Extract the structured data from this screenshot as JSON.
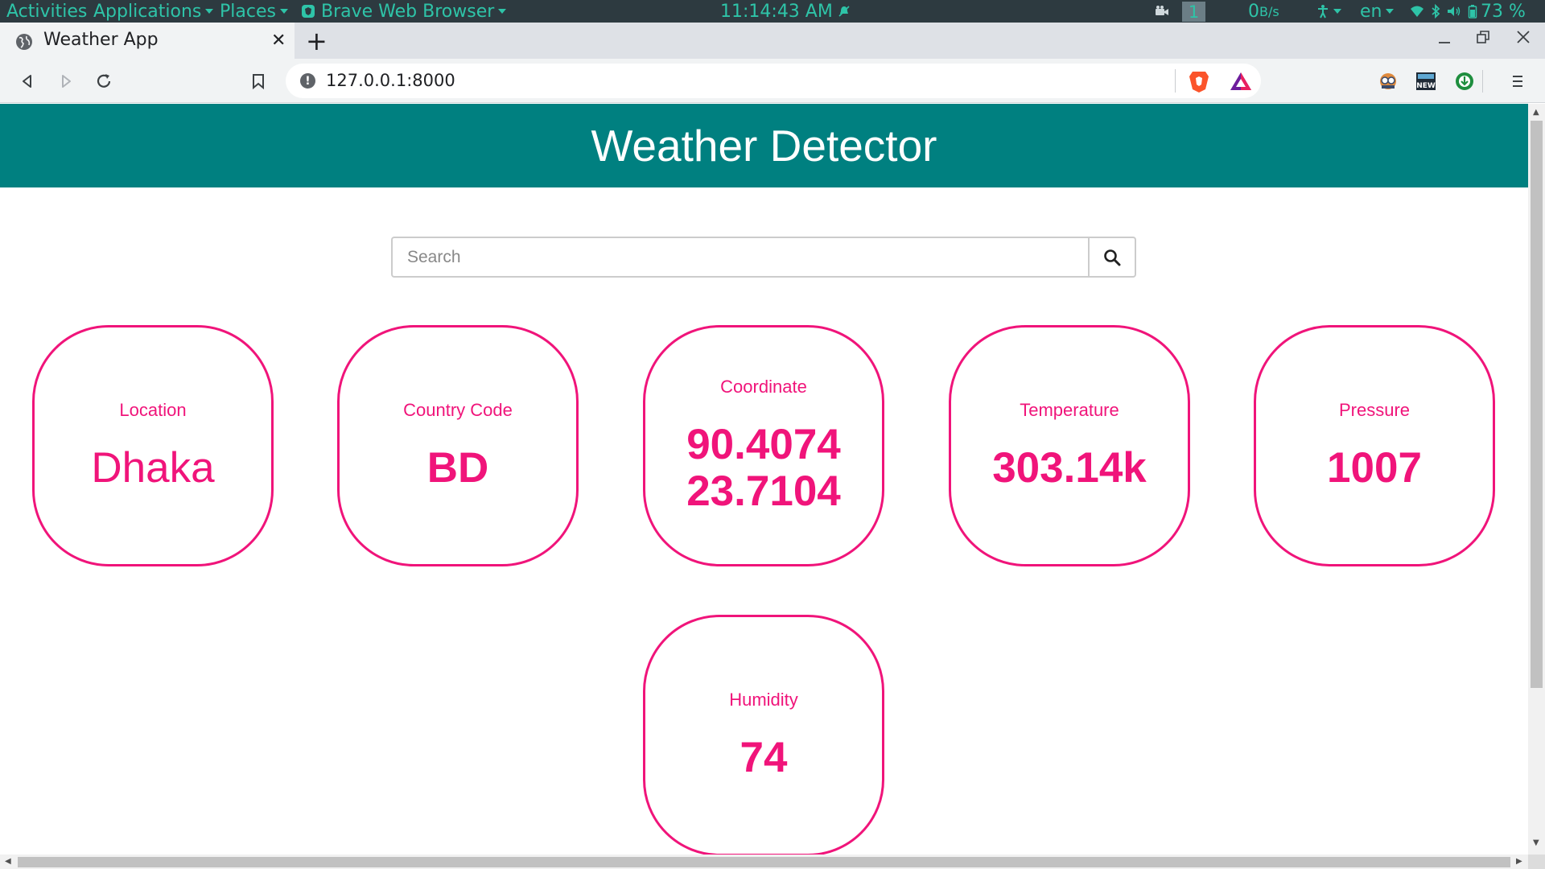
{
  "topbar": {
    "activities": "Activities",
    "applications": "Applications",
    "places": "Places",
    "browser_name": "Brave Web Browser",
    "clock": "11:14:43 AM",
    "workspace": "1",
    "net_speed_value": "0",
    "net_speed_unit": "B/s",
    "language": "en",
    "battery": "73 %"
  },
  "tab": {
    "title": "Weather App",
    "close": "✕",
    "new_tab": "+"
  },
  "toolbar": {
    "url": "127.0.0.1:8000",
    "info_glyph": "!"
  },
  "page": {
    "header_title": "Weather Detector",
    "search": {
      "placeholder": "Search",
      "value": ""
    },
    "cards": {
      "location": {
        "label": "Location",
        "value": "Dhaka"
      },
      "country_code": {
        "label": "Country Code",
        "value": "BD"
      },
      "coordinate": {
        "label": "Coordinate",
        "value_lon": "90.4074",
        "value_lat": "23.7104"
      },
      "temperature": {
        "label": "Temperature",
        "value": "303.14k"
      },
      "pressure": {
        "label": "Pressure",
        "value": "1007"
      },
      "humidity": {
        "label": "Humidity",
        "value": "74"
      }
    }
  },
  "colors": {
    "header_bg": "#008080",
    "card_accent": "#f0147a",
    "topbar_bg": "#2d3a40",
    "topbar_text": "#2ec4a8"
  }
}
